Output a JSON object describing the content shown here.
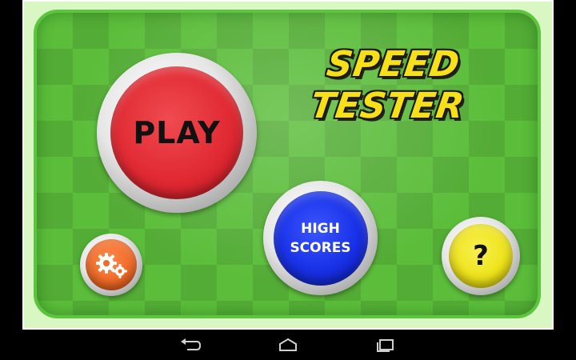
{
  "game": {
    "title_line1": "SPEED",
    "title_line2": "TESTER"
  },
  "buttons": {
    "play": "PLAY",
    "high_scores_line1": "HIGH",
    "high_scores_line2": "SCORES",
    "help": "?"
  },
  "icons": {
    "settings": "gears-icon",
    "nav_back": "back-icon",
    "nav_home": "home-icon",
    "nav_recents": "recent-apps-icon"
  },
  "colors": {
    "board_green": "#5bbd3a",
    "play_red": "#e12a33",
    "high_scores_blue": "#1830e6",
    "help_yellow": "#eee31a",
    "settings_orange": "#f26a26",
    "title_yellow": "#f7e019"
  }
}
